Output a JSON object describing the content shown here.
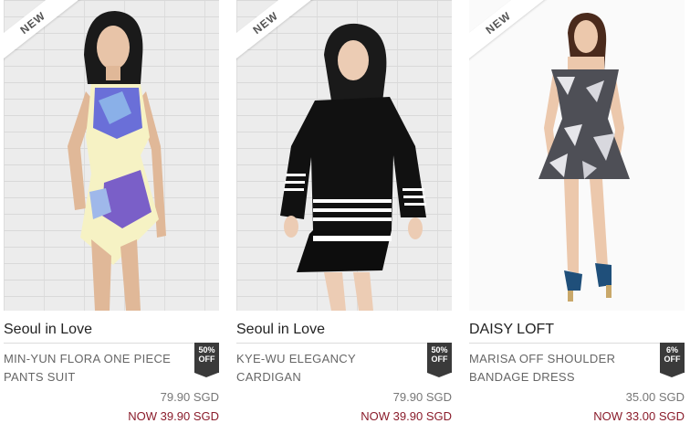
{
  "products": [
    {
      "ribbon": "NEW",
      "brand": "Seoul in Love",
      "name_line1": "MIN-YUN FLORA ONE PIECE",
      "name_line2": "PANTS SUIT",
      "badge_pct": "50%",
      "badge_word": "OFF",
      "price": "79.90 SGD",
      "now_price": "NOW 39.90 SGD"
    },
    {
      "ribbon": "NEW",
      "brand": "Seoul in Love",
      "name_line1": "KYE-WU ELEGANCY",
      "name_line2": "CARDIGAN",
      "badge_pct": "50%",
      "badge_word": "OFF",
      "price": "79.90 SGD",
      "now_price": "NOW 39.90 SGD"
    },
    {
      "ribbon": "NEW",
      "brand": "DAISY LOFT",
      "name_line1": "MARISA OFF SHOULDER",
      "name_line2": "BANDAGE DRESS",
      "badge_pct": "6%",
      "badge_word": "OFF",
      "price": "35.00 SGD",
      "now_price": "NOW 33.00 SGD"
    }
  ],
  "colors": {
    "sale_price": "#8a1c2b",
    "badge_bg": "#3a3a3a"
  }
}
